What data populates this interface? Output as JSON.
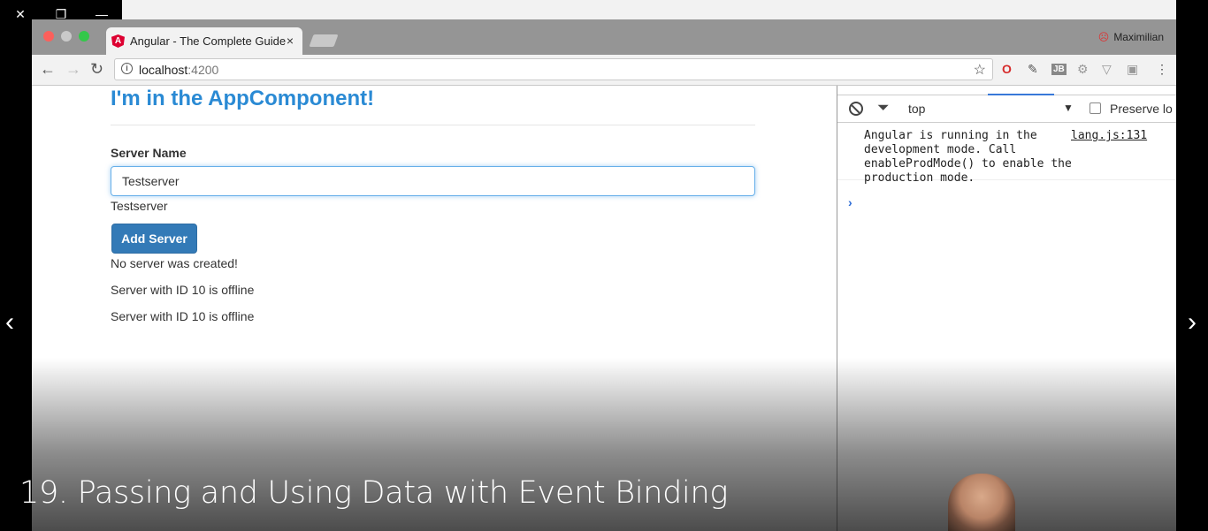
{
  "window_controls": {
    "close": "✕",
    "restore": "❐",
    "minimize": "—"
  },
  "browser": {
    "tab_title": "Angular - The Complete Guide",
    "tab_icon": "A",
    "tab_close": "×",
    "profile_name": "Maximilian",
    "address": {
      "host": "localhost",
      "port": ":4200"
    },
    "traffic_colors": [
      "#fc605b",
      "#fdbc40",
      "#34c84a"
    ],
    "extension_icons": [
      "opera-icon",
      "eyedropper-icon",
      "jb-icon",
      "gear-extension-icon",
      "vue-icon",
      "camera-icon"
    ]
  },
  "page": {
    "heading": "I'm in the AppComponent!",
    "server_name_label": "Server Name",
    "server_name_value": "Testserver",
    "echo_text": "Testserver",
    "add_button": "Add Server",
    "creation_status": "No server was created!",
    "servers": [
      "Server with ID 10 is offline",
      "Server with ID 10 is offline"
    ]
  },
  "devtools": {
    "context": "top",
    "preserve_log": "Preserve lo",
    "message": "Angular is running in the\ndevelopment mode. Call\nenableProdMode() to enable the\nproduction mode.",
    "message_source": "lang.js:131",
    "prompt": "›"
  },
  "video": {
    "caption": "19. Passing and Using Data with Event Binding",
    "prev": "‹",
    "next": "›"
  }
}
